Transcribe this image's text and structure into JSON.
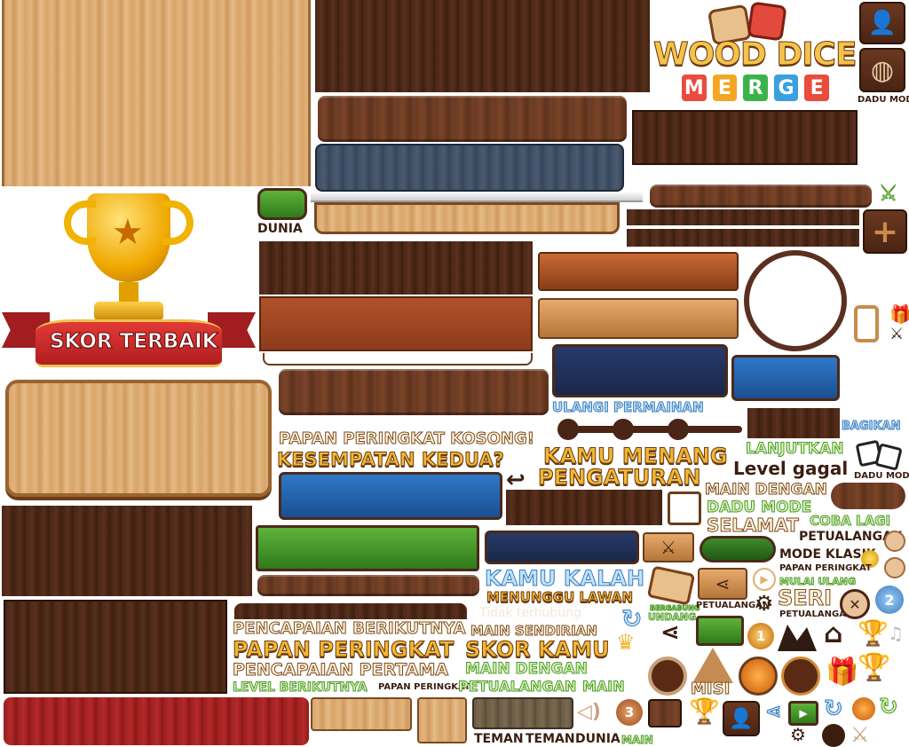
{
  "logo": {
    "line1": "WOOD DICE",
    "line2_letters": [
      "M",
      "E",
      "R",
      "G",
      "E"
    ],
    "line2_colors": [
      "#e94b3c",
      "#f4a623",
      "#3bb34a",
      "#3aa0e0",
      "#e94b3c"
    ]
  },
  "trophy_banner": {
    "label": "SKOR TERBAIK"
  },
  "small_labels": {
    "dunia_top": "DUNIA",
    "dadu_mode_top": "DADU MODE",
    "dadu_mode_right": "DADU MODE",
    "bagikan": "BAGIKAN",
    "lanjutkan": "LANJUTKAN",
    "level_gagal": "Level gagal",
    "ulangi_permainan": "ULANGI PERMAINAN"
  },
  "headings": {
    "papan_kosong": "PAPAN PERINGKAT KOSONG!",
    "kesempatan_kedua": "KESEMPATAN KEDUA?",
    "kamu_menang": "KAMU MENANG",
    "pengaturan": "PENGATURAN",
    "main_dengan": "MAIN DENGAN",
    "dadu_mode": "DADU MODE",
    "selamat": "SELAMAT",
    "coba_lagi": "COBA LAGI",
    "petualangan": "PETUALANGAN",
    "mode_klasik": "MODE KLASIK",
    "papan_peringkat_small": "PAPAN PERINGKAT",
    "mulai_ulang": "MULAI ULANG",
    "seri": "SERI",
    "petualangan_small": "PETUALANGAN",
    "kamu_kalah": "KAMU KALAH",
    "menunggu_lawan": "MENUNGGU LAWAN",
    "tidak_terhubung": "Tidak terhubung",
    "bergabung": "BERGABUNG",
    "undang": "UNDANG",
    "petualangan_btn": "PETUALANGAN"
  },
  "bottom_texts": {
    "pencapaian_berikutnya": "PENCAPAIAN BERIKUTNYA",
    "main_sendirian": "MAIN SENDIRIAN",
    "papan_peringkat": "PAPAN PERINGKAT",
    "skor_kamu": "SKOR KAMU",
    "pencapaian_pertama": "PENCAPAIAN PERTAMA",
    "main_dengan": "MAIN DENGAN",
    "level_berikutnya": "LEVEL BERIKUTNYA",
    "papan_peringkat_tiny": "PAPAN PERINGKAT",
    "petualangan": "PETUALANGAN",
    "main": "MAIN",
    "teman1": "TEMAN",
    "teman2": "TEMAN",
    "dunia": "DUNIA",
    "main2": "MAIN",
    "misi": "MISI"
  },
  "badges": {
    "rank1": "1",
    "rank2": "2",
    "rank3": "3"
  },
  "glyphs": {
    "plus": "+",
    "close": "✕",
    "back_arrow": "↩",
    "share": "⋖",
    "gear": "⚙",
    "home": "⌂",
    "gift": "🎁",
    "play": "▶",
    "music": "♫",
    "crown": "♛",
    "refresh": "↻",
    "swords": "⚔",
    "globe": "◍",
    "speaker": "◁)",
    "user": "👤"
  }
}
